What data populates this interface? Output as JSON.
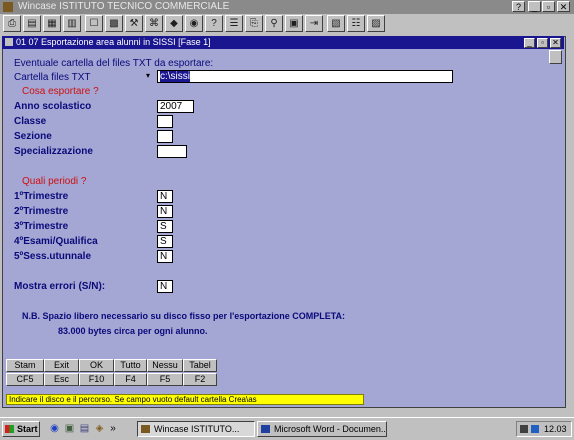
{
  "app": {
    "title": "Wincase ISTITUTO TECNICO COMMERCIALE"
  },
  "app_title_buttons": [
    "?",
    "_",
    "▫",
    "✕"
  ],
  "toolbar": {
    "icons": [
      "print-icon",
      "open-icon",
      "list-icon",
      "folder-icon",
      "doc-icon",
      "table-icon",
      "tools-icon",
      "network-icon",
      "eraser-icon",
      "disk-icon",
      "help-query-icon",
      "menu-icon",
      "copy-icon",
      "binoculars-icon",
      "copy2-icon",
      "exit-icon",
      "select-icon",
      "settings-icon",
      "chart-icon"
    ],
    "glyphs": [
      "⎙",
      "▤",
      "▦",
      "▥",
      "☐",
      "▩",
      "⚒",
      "⌘",
      "◆",
      "◉",
      "?",
      "☰",
      "⎘",
      "⚲",
      "▣",
      "⇥",
      "▧",
      "☷",
      "▨"
    ]
  },
  "window": {
    "title": "01 07 Esportazione area alunni in SISSI [Fase 1]",
    "buttons": [
      "_",
      "▫",
      "✕"
    ]
  },
  "form": {
    "heading": "Eventuale cartella del files TXT da esportare:",
    "folder_label": "Cartella files TXT",
    "folder_value": "c:\\sissi",
    "section1": "Cosa esportare ?",
    "anno_label": "Anno scolastico",
    "anno_value": "2007",
    "classe_label": "Classe",
    "classe_value": "",
    "sezione_label": "Sezione",
    "sezione_value": "",
    "spec_label": "Specializzazione",
    "spec_value": "",
    "section2": "Quali periodi ?",
    "periods": [
      {
        "label": "1ºTrimestre",
        "value": "N"
      },
      {
        "label": "2ºTrimestre",
        "value": "N"
      },
      {
        "label": "3ºTrimestre",
        "value": "S"
      },
      {
        "label": "4ºEsami/Qualifica",
        "value": "S"
      },
      {
        "label": "5ºSess.utunnale",
        "value": "N"
      }
    ],
    "errors_label": "Mostra errori (S/N):",
    "errors_value": "N",
    "note_line1": "N.B. Spazio libero necessario su disco fisso per l'esportazione COMPLETA:",
    "note_line2": "83.000 bytes circa per ogni alunno."
  },
  "function_keys": {
    "row1": [
      "Stam",
      "Exit",
      "OK",
      "Tutto",
      "Nessu",
      "Tabel"
    ],
    "row2": [
      "CF5",
      "Esc",
      "F10",
      "F4",
      "F5",
      "F2"
    ]
  },
  "status_bar": "Indicare il disco e il percorso. Se campo vuoto default cartella Crea\\as",
  "taskbar": {
    "start": "Start",
    "quick_icons": [
      "◉",
      "▣",
      "▤",
      "◈",
      "»"
    ],
    "tasks": [
      {
        "label": "Wincase ISTITUTO..."
      },
      {
        "label": "Microsoft Word - Documen..."
      }
    ],
    "clock": "12.03"
  },
  "colors": {
    "window_bg": "#a4a6d3",
    "title_active": "#1a168f",
    "status_bg": "#ffff00",
    "label_red": "#d01010"
  }
}
